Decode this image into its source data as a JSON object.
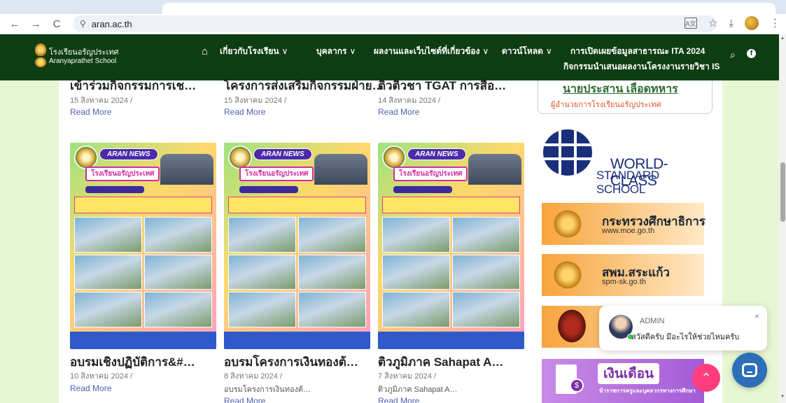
{
  "browser": {
    "url": "aran.ac.th",
    "back_icon": "←",
    "forward_icon": "→",
    "reload_icon": "C",
    "site_info_icon": "⚲",
    "star_icon": "☆",
    "download_icon": "⤓",
    "menu_icon": "⋮",
    "translate_icon": "A文"
  },
  "header": {
    "brand_th": "โรงเรียนอรัญประเทศ",
    "brand_en": "Aranyaprathet School",
    "home_icon": "⌂",
    "menu": [
      {
        "label": "เกี่ยวกับโรงเรียน",
        "chevron": "∨"
      },
      {
        "label": "บุคลากร",
        "chevron": "∨"
      },
      {
        "label": "ผลงานและเว็บไซต์ที่เกี่ยวข้อง",
        "chevron": "∨"
      },
      {
        "label": "ดาวน์โหลด",
        "chevron": "∨"
      }
    ],
    "ita_label": "การเปิดเผยข้อมูลสาธารณะ ITA 2024",
    "is_label": "กิจกรรมนำเสนอผลงานโครงงานรายวิชา IS",
    "search_icon": "⌕",
    "facebook_icon": "f"
  },
  "top_posts": [
    {
      "title": "เข้าร่วมกิจกรรมการเช…",
      "date": "15 สิงหาคม 2024 /",
      "read_more": "Read More"
    },
    {
      "title": "โครงการส่งเสริมกิจกรรมฝ่าย…",
      "date": "15 สิงหาคม 2024 /",
      "read_more": "Read More"
    },
    {
      "title": "ติวติวชา TGAT การสื่อ…",
      "date": "14 สิงหาคม 2024 /",
      "read_more": "Read More"
    }
  ],
  "posts": [
    {
      "badge": "ARAN NEWS",
      "banner": "โรงเรียนอรัญประเทศ",
      "title": "อบรมเชิงปฏิบัติการ&#…",
      "date": "10 สิงหาคม 2024 /",
      "excerpt": "",
      "read_more": "Read More"
    },
    {
      "badge": "ARAN NEWS",
      "banner": "โรงเรียนอรัญประเทศ",
      "title": "อบรมโครงการเงินทองต้…",
      "date": "8 สิงหาคม 2024 /",
      "excerpt": "อบรมโครงการเงินทองต้…",
      "read_more": "Read More"
    },
    {
      "badge": "ARAN NEWS",
      "banner": "โรงเรียนอรัญประเทศ",
      "title": "ติวภูมิภาค Sahapat A…",
      "date": "7 สิงหาคม 2024 /",
      "excerpt": "ติวภูมิภาค Sahapat A…",
      "read_more": "Read More"
    }
  ],
  "sidebar": {
    "principal_name": "นายประสาน เลือดทหาร",
    "principal_role": "ผู้อำนวยการโรงเรียนอรัญประเทศ",
    "world_class_line1": "WORLD-CLASS",
    "world_class_line2": "STANDARD SCHOOL",
    "banners": [
      {
        "title": "กระทรวงศึกษาธิการ",
        "subtitle": "www.moe.go.th"
      },
      {
        "title": "สพม.สระแก้ว",
        "subtitle": "spm-sk.go.th"
      }
    ],
    "salary_title": "เงินเดือน",
    "salary_subtitle": "ข้าราชการครูและบุคลากรทางการศึกษา",
    "salary_coin": "$"
  },
  "chat": {
    "name": "ADMIN",
    "message": "สวัสดีครับ มีอะไรให้ช่วยไหมครับ",
    "close_icon": "×",
    "scroll_top_icon": "⌃"
  }
}
